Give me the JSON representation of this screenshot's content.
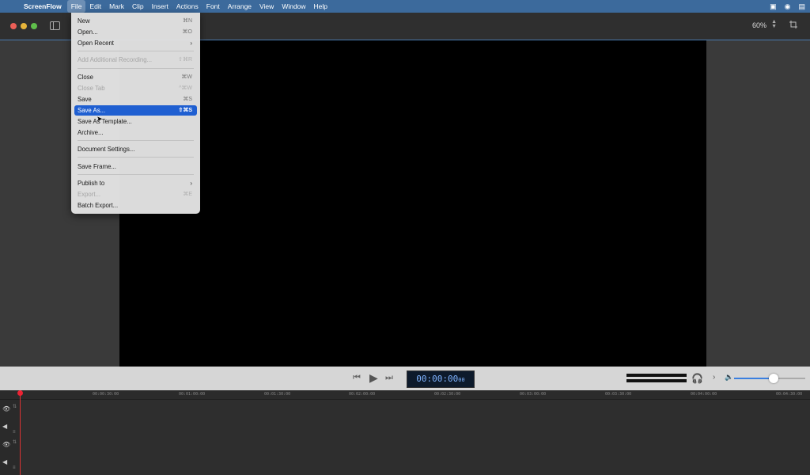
{
  "menubar": {
    "app_name": "ScreenFlow",
    "items": [
      "File",
      "Edit",
      "Mark",
      "Clip",
      "Insert",
      "Actions",
      "Font",
      "Arrange",
      "View",
      "Window",
      "Help"
    ]
  },
  "toolbar": {
    "zoom": "60%"
  },
  "file_menu": {
    "items": [
      {
        "label": "New",
        "shortcut": "⌘N"
      },
      {
        "label": "Open...",
        "shortcut": "⌘O"
      },
      {
        "label": "Open Recent",
        "shortcut": "›"
      },
      {
        "label": "Add Additional Recording...",
        "shortcut": "⇧⌘R"
      },
      {
        "label": "Close",
        "shortcut": "⌘W"
      },
      {
        "label": "Close Tab",
        "shortcut": "^⌘W"
      },
      {
        "label": "Save",
        "shortcut": "⌘S"
      },
      {
        "label": "Save As...",
        "shortcut": "⇧⌘S"
      },
      {
        "label": "Save As Template...",
        "shortcut": ""
      },
      {
        "label": "Archive...",
        "shortcut": ""
      },
      {
        "label": "Document Settings...",
        "shortcut": ""
      },
      {
        "label": "Save Frame...",
        "shortcut": ""
      },
      {
        "label": "Publish to",
        "shortcut": "›"
      },
      {
        "label": "Export...",
        "shortcut": "⌘E"
      },
      {
        "label": "Batch Export...",
        "shortcut": ""
      }
    ]
  },
  "transport": {
    "timecode": "00:00:00",
    "timecode_frames": "00",
    "volume_level": 0.55
  },
  "ruler": {
    "ticks": [
      "00:00:30:00",
      "00:01:00:00",
      "00:01:30:00",
      "00:02:00:00",
      "00:02:30:00",
      "00:03:00:00",
      "00:03:30:00",
      "00:04:00:00",
      "00:04:30:00"
    ]
  },
  "colors": {
    "menubar": "#3c6a9c",
    "highlight": "#1f5fd1",
    "playhead": "#e22233",
    "timecode_text": "#7fb3ff"
  }
}
